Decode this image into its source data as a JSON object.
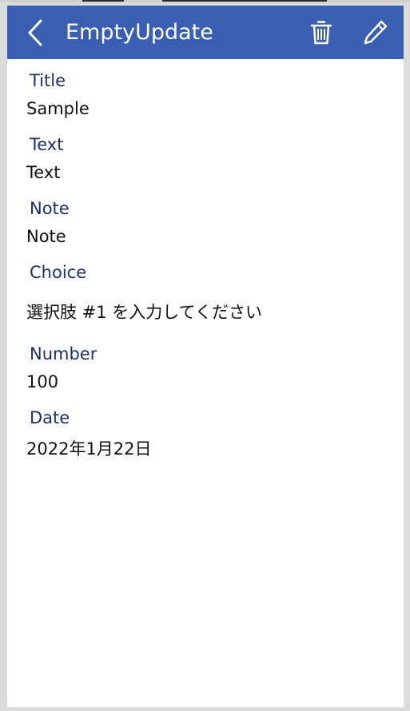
{
  "header": {
    "title": "EmptyUpdate",
    "back_icon": "chevron-left-icon",
    "delete_icon": "trash-icon",
    "edit_icon": "pencil-icon"
  },
  "fields": {
    "title": {
      "label": "Title",
      "value": "Sample"
    },
    "text": {
      "label": "Text",
      "value": "Text"
    },
    "note": {
      "label": "Note",
      "value": "Note"
    },
    "choice": {
      "label": "Choice",
      "value": "選択肢 #1 を入力してください"
    },
    "number": {
      "label": "Number",
      "value": "100"
    },
    "date": {
      "label": "Date",
      "value": "2022年1月22日"
    }
  },
  "colors": {
    "header_bg": "#3a5fb2",
    "label_text": "#1e2f6b",
    "value_text": "#111111",
    "page_bg": "#dcdcdc",
    "card_bg": "#ffffff"
  }
}
